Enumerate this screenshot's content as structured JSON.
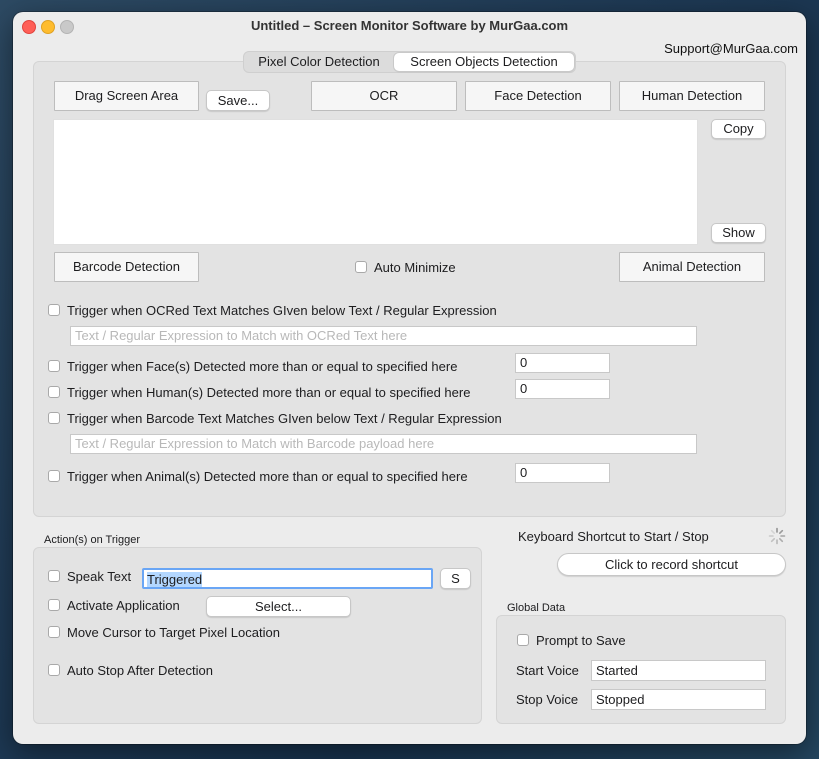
{
  "window": {
    "title": "Untitled – Screen Monitor Software by MurGaa.com",
    "support_link": "Support@MurGaa.com",
    "traffic_lights": {
      "close": "#ff5f57",
      "minimize": "#febc2e",
      "zoom": "#c9c9c9"
    }
  },
  "tabs": [
    {
      "label": "Pixel Color Detection",
      "selected": false
    },
    {
      "label": "Screen Objects Detection",
      "selected": true
    }
  ],
  "detection": {
    "drag_screen_area": "Drag Screen Area",
    "save": "Save...",
    "ocr": "OCR",
    "face_detection": "Face Detection",
    "human_detection": "Human Detection",
    "copy": "Copy",
    "show": "Show",
    "output_text": "",
    "barcode_detection": "Barcode Detection",
    "auto_minimize": {
      "label": "Auto Minimize",
      "checked": false
    },
    "animal_detection": "Animal Detection"
  },
  "triggers": {
    "ocr_match": {
      "label": "Trigger when OCRed Text Matches GIven below Text / Regular Expression",
      "checked": false
    },
    "ocr_pattern": {
      "value": "",
      "placeholder": "Text / Regular Expression to Match with OCRed Text here"
    },
    "faces": {
      "label": "Trigger when Face(s) Detected more than or equal to specified here",
      "checked": false,
      "value": "0"
    },
    "humans": {
      "label": "Trigger when Human(s) Detected more than or equal to specified here",
      "checked": false,
      "value": "0"
    },
    "barcode_match": {
      "label": "Trigger when Barcode Text Matches GIven below Text / Regular Expression",
      "checked": false
    },
    "barcode_pattern": {
      "value": "",
      "placeholder": "Text / Regular Expression to Match with Barcode payload here"
    },
    "animals": {
      "label": "Trigger when Animal(s) Detected more than or equal to specified here",
      "checked": false,
      "value": "0"
    }
  },
  "actions": {
    "title": "Action(s) on Trigger",
    "speak_text": {
      "label": "Speak Text",
      "checked": false,
      "value": "Triggered",
      "button": "S"
    },
    "activate_app": {
      "label": "Activate Application",
      "checked": false,
      "button": "Select..."
    },
    "move_cursor": {
      "label": "Move Cursor to Target Pixel Location",
      "checked": false
    },
    "auto_stop": {
      "label": "Auto Stop After Detection",
      "checked": false
    }
  },
  "shortcut": {
    "title": "Keyboard Shortcut to Start / Stop",
    "button": "Click to record shortcut",
    "spinner": "progress-spinner"
  },
  "global_data": {
    "title": "Global Data",
    "prompt_to_save": {
      "label": "Prompt to Save",
      "checked": false
    },
    "start_voice": {
      "label": "Start Voice",
      "value": "Started"
    },
    "stop_voice": {
      "label": "Stop Voice",
      "value": "Stopped"
    }
  }
}
